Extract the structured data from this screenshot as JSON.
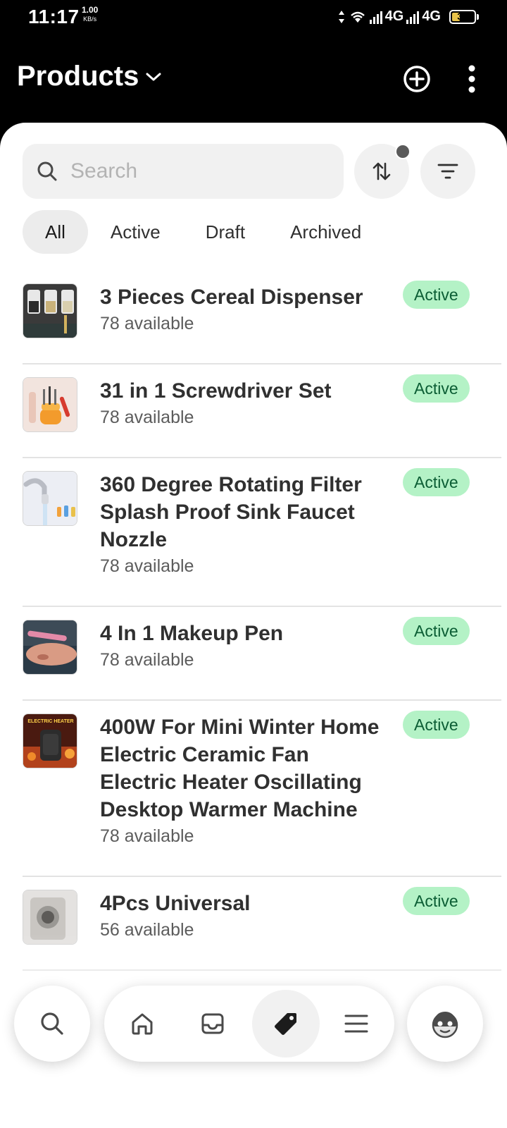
{
  "status": {
    "time": "11:17",
    "speed_value": "1.00",
    "speed_unit": "KB/s",
    "network1": "4G",
    "network2": "4G",
    "battery": "33"
  },
  "header": {
    "title": "Products"
  },
  "search": {
    "placeholder": "Search",
    "value": ""
  },
  "tabs": [
    {
      "label": "All"
    },
    {
      "label": "Active"
    },
    {
      "label": "Draft"
    },
    {
      "label": "Archived"
    }
  ],
  "products": [
    {
      "title": "3 Pieces Cereal Dispenser",
      "available": "78 available",
      "status": "Active"
    },
    {
      "title": "31 in 1 Screwdriver Set",
      "available": "78 available",
      "status": "Active"
    },
    {
      "title": "360 Degree Rotating Filter Splash Proof Sink Faucet Nozzle",
      "available": "78 available",
      "status": "Active"
    },
    {
      "title": "4 In 1 Makeup Pen",
      "available": "78 available",
      "status": "Active"
    },
    {
      "title": "400W For Mini Winter Home Electric Ceramic Fan Electric Heater Oscillating Desktop Warmer Machine",
      "available": "78 available",
      "status": "Active"
    },
    {
      "title": "4Pcs Universal",
      "available": "56 available",
      "status": "Active"
    }
  ],
  "thumb_text": {
    "heater_label": "ELECTRIC HEATER"
  },
  "colors": {
    "active_badge_bg": "#b4f2c6",
    "active_badge_text": "#0b5d34",
    "header_bg": "#000000",
    "battery": "#e9c34a"
  },
  "nav": {
    "items": [
      "search-icon",
      "home-icon",
      "inbox-icon",
      "tag-icon",
      "menu-icon",
      "profile-avatar-icon"
    ],
    "active": "tag-icon"
  }
}
